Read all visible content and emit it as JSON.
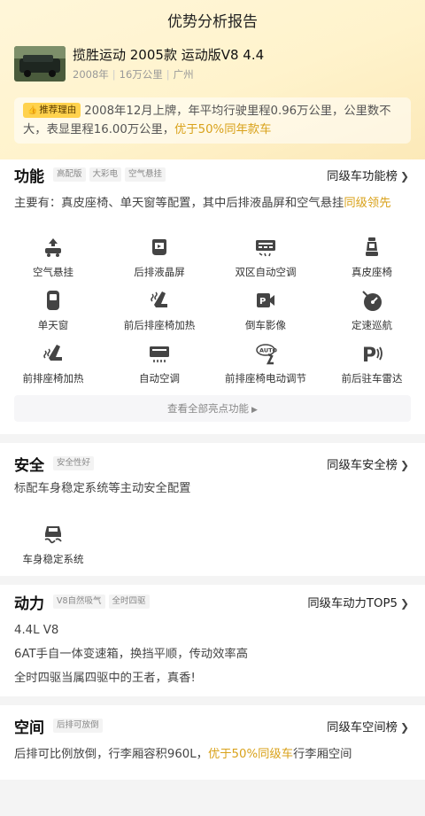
{
  "header": {
    "title": "优势分析报告"
  },
  "car": {
    "name": "揽胜运动 2005款 运动版V8 4.4",
    "year": "2008年",
    "mileage": "16万公里",
    "city": "广州"
  },
  "recommend": {
    "badge": "推荐理由",
    "text": "2008年12月上牌，年平均行驶里程0.96万公里，公里数不大，表显里程16.00万公里，",
    "highlight": "优于50%同年款车"
  },
  "features": {
    "title": "功能",
    "tags": [
      "高配版",
      "大彩电",
      "空气悬挂"
    ],
    "rank_link": "同级车功能榜",
    "desc_prefix": "主要有：真皮座椅、单天窗等配置，其中后排液晶屏和空气悬挂",
    "desc_highlight": "同级领先",
    "items": [
      {
        "label": "空气悬挂",
        "icon": "air-suspension-icon"
      },
      {
        "label": "后排液晶屏",
        "icon": "rear-screen-icon"
      },
      {
        "label": "双区自动空调",
        "icon": "dual-zone-ac-icon"
      },
      {
        "label": "真皮座椅",
        "icon": "leather-seat-icon"
      },
      {
        "label": "单天窗",
        "icon": "sunroof-icon"
      },
      {
        "label": "前后排座椅加热",
        "icon": "seat-heating-icon"
      },
      {
        "label": "倒车影像",
        "icon": "reverse-camera-icon"
      },
      {
        "label": "定速巡航",
        "icon": "cruise-control-icon"
      },
      {
        "label": "前排座椅加热",
        "icon": "front-seat-heating-icon"
      },
      {
        "label": "自动空调",
        "icon": "auto-ac-icon"
      },
      {
        "label": "前排座椅电动调节",
        "icon": "power-seat-icon"
      },
      {
        "label": "前后驻车雷达",
        "icon": "parking-radar-icon"
      }
    ],
    "view_all": "查看全部亮点功能"
  },
  "safety": {
    "title": "安全",
    "tags": [
      "安全性好"
    ],
    "rank_link": "同级车安全榜",
    "desc": "标配车身稳定系统等主动安全配置",
    "items": [
      {
        "label": "车身稳定系统",
        "icon": "stability-control-icon"
      }
    ]
  },
  "power": {
    "title": "动力",
    "tags": [
      "V8自然吸气",
      "全时四驱"
    ],
    "rank_link": "同级车动力TOP5",
    "lines": [
      "4.4L V8",
      "6AT手自一体变速箱，换挡平顺，传动效率高",
      "全时四驱当属四驱中的王者，真香!"
    ]
  },
  "space": {
    "title": "空间",
    "tags": [
      "后排可放倒"
    ],
    "rank_link": "同级车空间榜",
    "desc_prefix": "后排可比例放倒，行李厢容积960L，",
    "desc_highlight": "优于50%同级车",
    "desc_suffix": "行李厢空间"
  },
  "colors": {
    "accent": "#d9a21b",
    "badge": "#ffd24d",
    "hero": "#fff3cc"
  }
}
